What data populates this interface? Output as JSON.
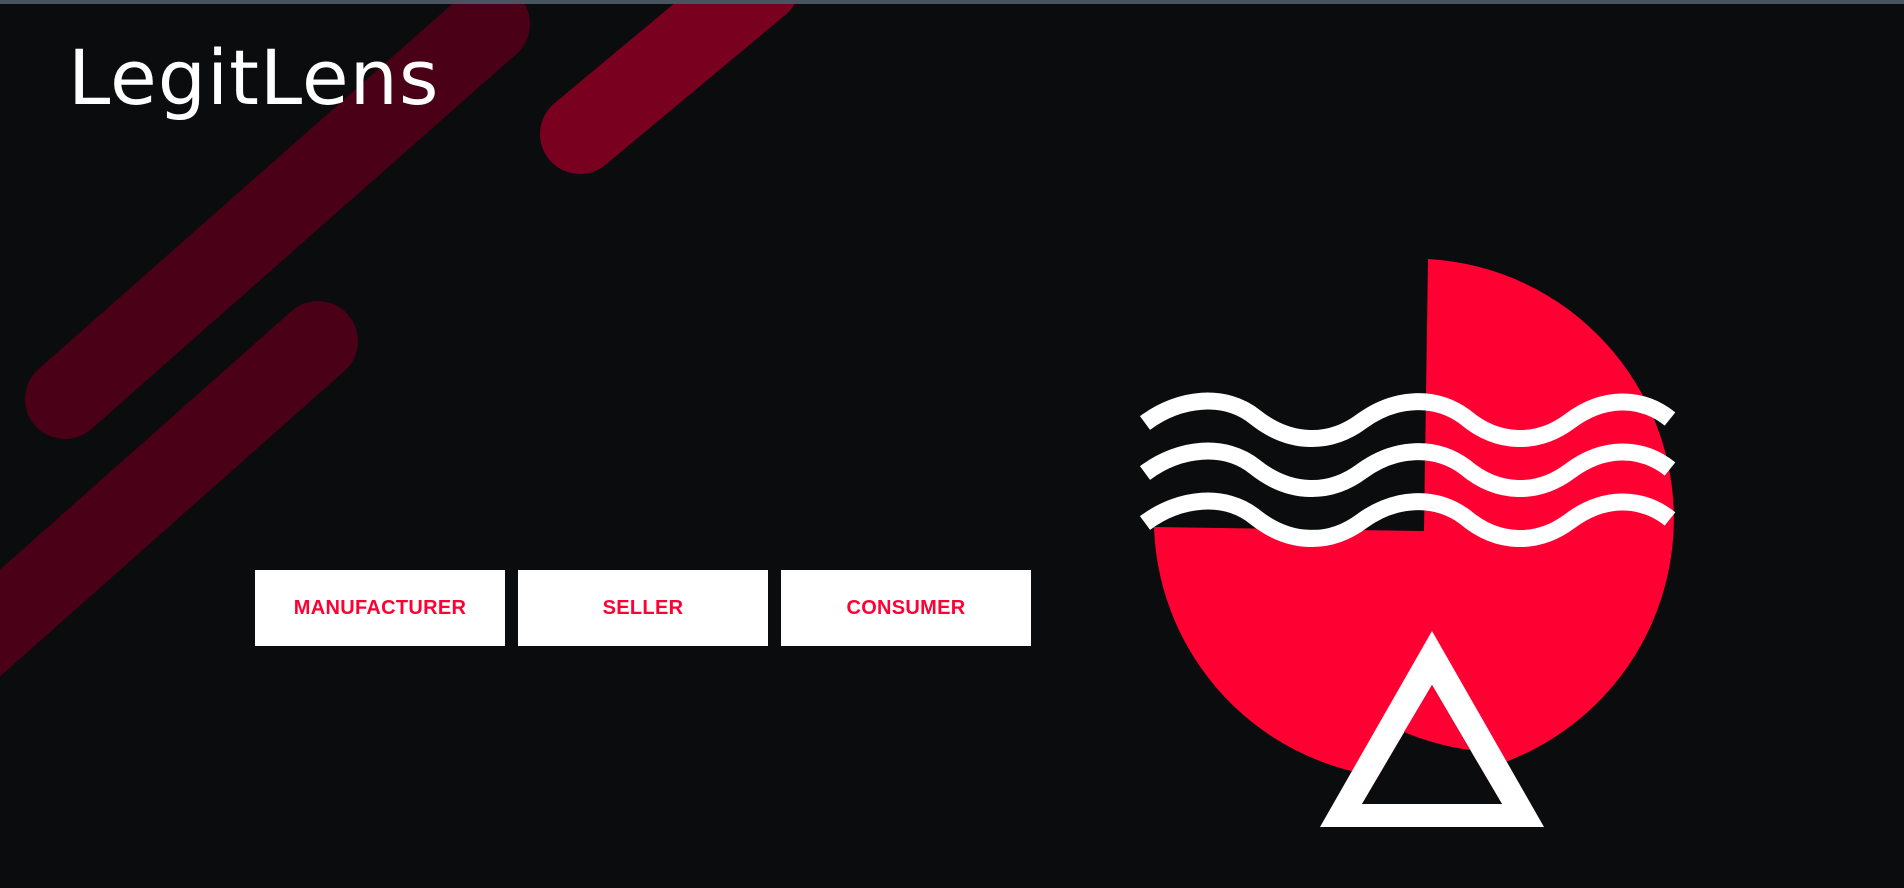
{
  "brand": {
    "name": "LegitLens"
  },
  "roles": {
    "manufacturer_label": "MANUFACTURER",
    "seller_label": "SELLER",
    "consumer_label": "CONSUMER"
  },
  "illustration": {
    "icons": [
      "red-circle-icon",
      "wave-lines-icon",
      "triangle-icon"
    ]
  },
  "colors": {
    "background": "#0b0c0e",
    "accent": "#ff0033",
    "decor_stripe": "#7a0020",
    "decor_stripe_dark": "#4a0017",
    "button_bg": "#ffffff",
    "text_light": "#ffffff"
  }
}
